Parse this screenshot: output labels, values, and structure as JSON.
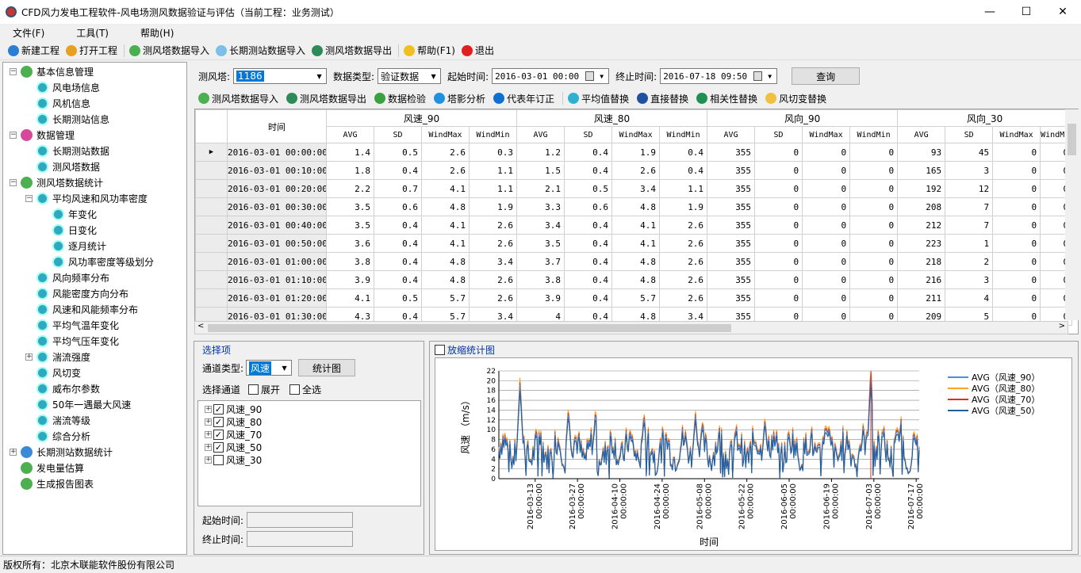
{
  "window": {
    "title": "CFD风力发电工程软件-风电场测风数据验证与评估（当前工程：业务测试）",
    "minimize": "—",
    "maximize": "☐",
    "close": "✕"
  },
  "menu": [
    "文件(F)",
    "工具(T)",
    "帮助(H)"
  ],
  "toolbar": [
    {
      "label": "新建工程",
      "icon": "new-project-icon",
      "color": "#2a7fd4"
    },
    {
      "label": "打开工程",
      "icon": "open-project-icon",
      "color": "#e8a020"
    },
    {
      "label": "测风塔数据导入",
      "icon": "import-icon",
      "color": "#4caf50"
    },
    {
      "label": "长期测站数据导入",
      "icon": "station-import-icon",
      "color": "#7cc0e8"
    },
    {
      "label": "测风塔数据导出",
      "icon": "export-icon",
      "color": "#2e8b57"
    },
    {
      "label": "帮助(F1)",
      "icon": "help-icon",
      "color": "#f0c020"
    },
    {
      "label": "退出",
      "icon": "exit-icon",
      "color": "#e02020"
    }
  ],
  "tree": [
    {
      "label": "基本信息管理",
      "level": 0,
      "icon": "green",
      "exp": "−"
    },
    {
      "label": "风电场信息",
      "level": 1,
      "icon": "teal"
    },
    {
      "label": "风机信息",
      "level": 1,
      "icon": "teal"
    },
    {
      "label": "长期测站信息",
      "level": 1,
      "icon": "teal"
    },
    {
      "label": "数据管理",
      "level": 0,
      "icon": "pink",
      "exp": "−"
    },
    {
      "label": "长期测站数据",
      "level": 1,
      "icon": "teal"
    },
    {
      "label": "测风塔数据",
      "level": 1,
      "icon": "teal"
    },
    {
      "label": "测风塔数据统计",
      "level": 0,
      "icon": "green",
      "exp": "−"
    },
    {
      "label": "平均风速和风功率密度",
      "level": 1,
      "icon": "teal",
      "exp": "−"
    },
    {
      "label": "年变化",
      "level": 2,
      "icon": "teal"
    },
    {
      "label": "日变化",
      "level": 2,
      "icon": "teal"
    },
    {
      "label": "逐月统计",
      "level": 2,
      "icon": "teal"
    },
    {
      "label": "风功率密度等级划分",
      "level": 2,
      "icon": "teal"
    },
    {
      "label": "风向频率分布",
      "level": 1,
      "icon": "teal"
    },
    {
      "label": "风能密度方向分布",
      "level": 1,
      "icon": "teal"
    },
    {
      "label": "风速和风能频率分布",
      "level": 1,
      "icon": "teal"
    },
    {
      "label": "平均气温年变化",
      "level": 1,
      "icon": "teal"
    },
    {
      "label": "平均气压年变化",
      "level": 1,
      "icon": "teal"
    },
    {
      "label": "湍流强度",
      "level": 1,
      "icon": "teal",
      "exp": "+"
    },
    {
      "label": "风切变",
      "level": 1,
      "icon": "teal"
    },
    {
      "label": "威布尔参数",
      "level": 1,
      "icon": "teal"
    },
    {
      "label": "50年一遇最大风速",
      "level": 1,
      "icon": "teal"
    },
    {
      "label": "湍流等级",
      "level": 1,
      "icon": "teal"
    },
    {
      "label": "综合分析",
      "level": 1,
      "icon": "teal"
    },
    {
      "label": "长期测站数据统计",
      "level": 0,
      "icon": "blue",
      "exp": "+"
    },
    {
      "label": "发电量估算",
      "level": 0,
      "icon": "green"
    },
    {
      "label": "生成报告图表",
      "level": 0,
      "icon": "green"
    }
  ],
  "query": {
    "tower_label": "测风塔:",
    "tower_value": "1186",
    "type_label": "数据类型:",
    "type_value": "验证数据",
    "start_label": "起始时间:",
    "start_value": "2016-03-01 00:00",
    "end_label": "终止时间:",
    "end_value": "2016-07-18 09:50",
    "query_button": "查询"
  },
  "actions": [
    {
      "label": "测风塔数据导入",
      "color": "#4caf50"
    },
    {
      "label": "测风塔数据导出",
      "color": "#2e8b57"
    },
    {
      "label": "数据检验",
      "color": "#3aa040"
    },
    {
      "label": "塔影分析",
      "color": "#2090e0"
    },
    {
      "label": "代表年订正",
      "color": "#1070d0"
    },
    {
      "label": "平均值替换",
      "color": "#30b0d0"
    },
    {
      "label": "直接替换",
      "color": "#2050a0"
    },
    {
      "label": "相关性替换",
      "color": "#209050"
    },
    {
      "label": "风切变替换",
      "color": "#f0c040"
    }
  ],
  "grid": {
    "time_header": "时间",
    "groups": [
      "风速_90",
      "风速_80",
      "风向_90",
      "风向_30"
    ],
    "sub": [
      "AVG",
      "SD",
      "WindMax",
      "WindMin"
    ],
    "rows": [
      [
        "2016-03-01 00:00:00",
        "1.4",
        "0.5",
        "2.6",
        "0.3",
        "1.2",
        "0.4",
        "1.9",
        "0.4",
        "355",
        "0",
        "0",
        "0",
        "93",
        "45",
        "0",
        "0"
      ],
      [
        "2016-03-01 00:10:00",
        "1.8",
        "0.4",
        "2.6",
        "1.1",
        "1.5",
        "0.4",
        "2.6",
        "0.4",
        "355",
        "0",
        "0",
        "0",
        "165",
        "3",
        "0",
        "0"
      ],
      [
        "2016-03-01 00:20:00",
        "2.2",
        "0.7",
        "4.1",
        "1.1",
        "2.1",
        "0.5",
        "3.4",
        "1.1",
        "355",
        "0",
        "0",
        "0",
        "192",
        "12",
        "0",
        "0"
      ],
      [
        "2016-03-01 00:30:00",
        "3.5",
        "0.6",
        "4.8",
        "1.9",
        "3.3",
        "0.6",
        "4.8",
        "1.9",
        "355",
        "0",
        "0",
        "0",
        "208",
        "7",
        "0",
        "0"
      ],
      [
        "2016-03-01 00:40:00",
        "3.5",
        "0.4",
        "4.1",
        "2.6",
        "3.4",
        "0.4",
        "4.1",
        "2.6",
        "355",
        "0",
        "0",
        "0",
        "212",
        "7",
        "0",
        "0"
      ],
      [
        "2016-03-01 00:50:00",
        "3.6",
        "0.4",
        "4.1",
        "2.6",
        "3.5",
        "0.4",
        "4.1",
        "2.6",
        "355",
        "0",
        "0",
        "0",
        "223",
        "1",
        "0",
        "0"
      ],
      [
        "2016-03-01 01:00:00",
        "3.8",
        "0.4",
        "4.8",
        "3.4",
        "3.7",
        "0.4",
        "4.8",
        "2.6",
        "355",
        "0",
        "0",
        "0",
        "218",
        "2",
        "0",
        "0"
      ],
      [
        "2016-03-01 01:10:00",
        "3.9",
        "0.4",
        "4.8",
        "2.6",
        "3.8",
        "0.4",
        "4.8",
        "2.6",
        "355",
        "0",
        "0",
        "0",
        "216",
        "3",
        "0",
        "0"
      ],
      [
        "2016-03-01 01:20:00",
        "4.1",
        "0.5",
        "5.7",
        "2.6",
        "3.9",
        "0.4",
        "5.7",
        "2.6",
        "355",
        "0",
        "0",
        "0",
        "211",
        "4",
        "0",
        "0"
      ],
      [
        "2016-03-01 01:30:00",
        "4.3",
        "0.4",
        "5.7",
        "3.4",
        "4",
        "0.4",
        "4.8",
        "3.4",
        "355",
        "0",
        "0",
        "0",
        "209",
        "5",
        "0",
        "0"
      ]
    ]
  },
  "options": {
    "title": "选择项",
    "channel_type_label": "通道类型:",
    "channel_type_value": "风速",
    "stat_button": "统计图",
    "select_channel_label": "选择通道",
    "expand_label": "展开",
    "select_all_label": "全选",
    "channels": [
      {
        "name": "风速_90",
        "checked": true
      },
      {
        "name": "风速_80",
        "checked": true
      },
      {
        "name": "风速_70",
        "checked": true
      },
      {
        "name": "风速_50",
        "checked": true
      },
      {
        "name": "风速_30",
        "checked": false
      }
    ],
    "start_label": "起始时间:",
    "end_label": "终止时间:"
  },
  "chart_panel": {
    "zoom_label": "放缩统计图"
  },
  "chart_data": {
    "type": "line",
    "xlabel": "时间",
    "ylabel": "风速 （m/s）",
    "ylim": [
      0,
      22
    ],
    "yticks": [
      0,
      2,
      4,
      6,
      8,
      10,
      12,
      14,
      16,
      18,
      20,
      22
    ],
    "xticks": [
      [
        "2016-03-13",
        "00:00:00"
      ],
      [
        "2016-03-27",
        "00:00:00"
      ],
      [
        "2016-04-10",
        "00:00:00"
      ],
      [
        "2016-04-24",
        "00:00:00"
      ],
      [
        "2016-05-08",
        "00:00:00"
      ],
      [
        "2016-05-22",
        "00:00:00"
      ],
      [
        "2016-06-05",
        "00:00:00"
      ],
      [
        "2016-06-19",
        "00:00:00"
      ],
      [
        "2016-07-03",
        "00:00:00"
      ],
      [
        "2016-07-17",
        "00:00:00"
      ]
    ],
    "x_range": [
      "2016-03-01",
      "2016-07-18"
    ],
    "legend_position": "right",
    "series": [
      {
        "name": "AVG（风速_90）",
        "color": "#4a90e2"
      },
      {
        "name": "AVG（风速_80）",
        "color": "#f5a623"
      },
      {
        "name": "AVG（风速_70）",
        "color": "#e03020"
      },
      {
        "name": "AVG（风速_50）",
        "color": "#1f5fa0"
      }
    ],
    "spikes": [
      {
        "date": "2016-03-08",
        "value": 19.5
      },
      {
        "date": "2016-03-14",
        "value": 11
      },
      {
        "date": "2016-03-24",
        "value": 14
      },
      {
        "date": "2016-04-02",
        "value": 14
      },
      {
        "date": "2016-04-18",
        "value": 13
      },
      {
        "date": "2016-05-05",
        "value": 13
      },
      {
        "date": "2016-05-28",
        "value": 12
      },
      {
        "date": "2016-06-17",
        "value": 11
      },
      {
        "date": "2016-07-02",
        "value": 22
      },
      {
        "date": "2016-07-12",
        "value": 12
      }
    ]
  },
  "status": "版权所有：北京木联能软件股份有限公司"
}
